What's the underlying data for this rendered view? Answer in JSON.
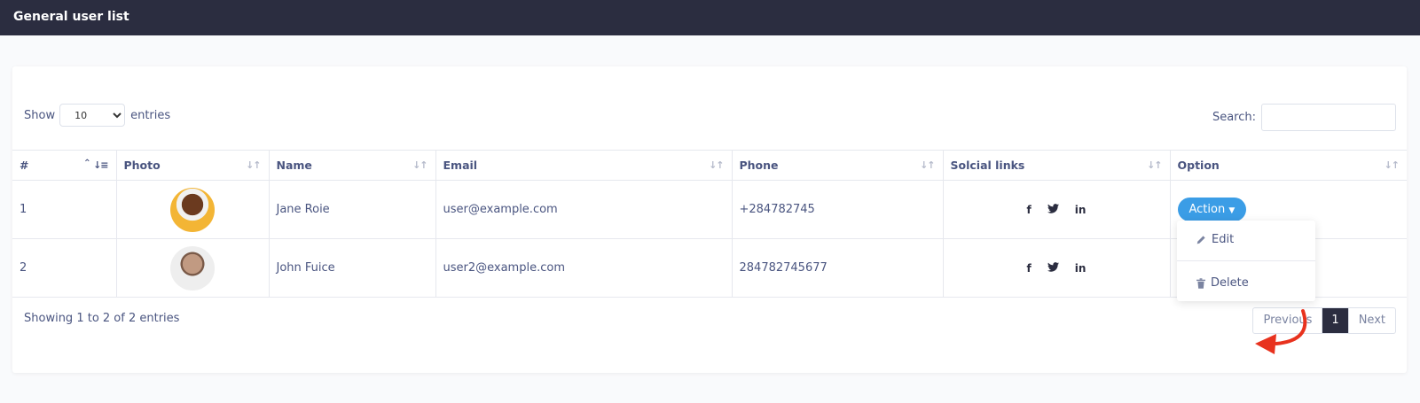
{
  "header": {
    "title": "General user list"
  },
  "length": {
    "show_label": "Show",
    "selected": "10",
    "entries_label": "entries"
  },
  "search": {
    "label": "Search:",
    "value": ""
  },
  "table": {
    "columns": [
      "#",
      "Photo",
      "Name",
      "Email",
      "Phone",
      "Solcial links",
      "Option"
    ],
    "rows": [
      {
        "id": "1",
        "photo": "avatar-1",
        "name": "Jane Roie",
        "email": "user@example.com",
        "phone": "+284782745"
      },
      {
        "id": "2",
        "photo": "avatar-2",
        "name": "John Fuice",
        "email": "user2@example.com",
        "phone": "284782745677"
      }
    ],
    "social_icons": [
      "f",
      "t",
      "in"
    ]
  },
  "action": {
    "button_label": "Action",
    "menu": {
      "edit_label": "Edit",
      "delete_label": "Delete"
    }
  },
  "footer": {
    "info": "Showing 1 to 2 of 2 entries",
    "previous_label": "Previous",
    "current_page": "1",
    "next_label": "Next"
  },
  "colors": {
    "topbar": "#2b2d40",
    "accent": "#3b9de6",
    "arrow": "#e8321e"
  }
}
